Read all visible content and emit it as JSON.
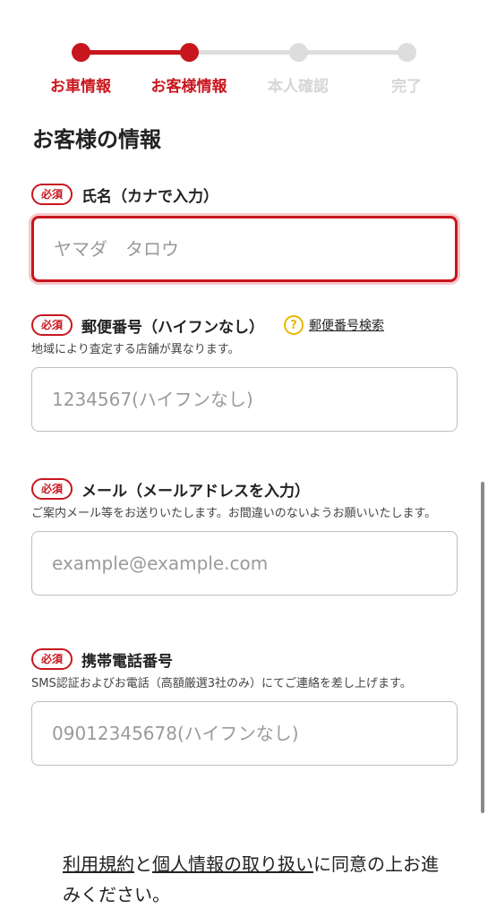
{
  "stepper": {
    "steps": [
      {
        "label": "お車情報",
        "state": "done"
      },
      {
        "label": "お客様情報",
        "state": "current"
      },
      {
        "label": "本人確認",
        "state": "todo"
      },
      {
        "label": "完了",
        "state": "todo"
      }
    ]
  },
  "section": {
    "title": "お客様の情報"
  },
  "required_badge": "必須",
  "fields": {
    "name": {
      "label": "氏名（カナで入力）",
      "placeholder": "ヤマダ　タロウ"
    },
    "postal": {
      "label": "郵便番号（ハイフンなし）",
      "help_link": "郵便番号検索",
      "help_icon": "?",
      "note": "地域により査定する店舗が異なります。",
      "placeholder": "1234567(ハイフンなし)"
    },
    "email": {
      "label": "メール（メールアドレスを入力）",
      "note": "ご案内メール等をお送りいたします。お間違いのないようお願いいたします。",
      "placeholder": "example@example.com"
    },
    "phone": {
      "label": "携帯電話番号",
      "note": "SMS認証およびお電話（高額厳選3社のみ）にてご連絡を差し上げます。",
      "placeholder": "09012345678(ハイフンなし)"
    }
  },
  "agreement": {
    "terms_link": "利用規約",
    "conj": "と",
    "privacy_link": "個人情報の取り扱い",
    "text": "に同意の上お進みください。"
  },
  "colors": {
    "accent": "#c8161d",
    "inactive": "#dddddd",
    "help": "#e6b800"
  }
}
